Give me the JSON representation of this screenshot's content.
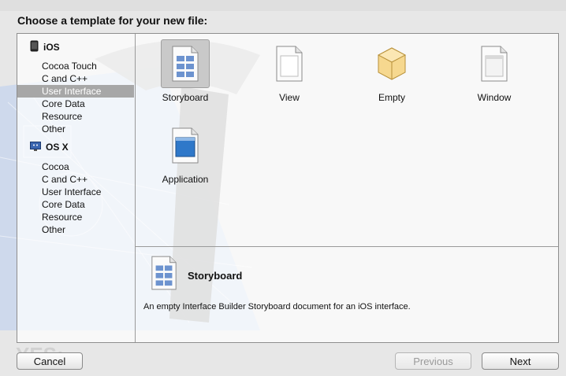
{
  "dialog": {
    "title": "Choose a template for your new file:"
  },
  "sidebar": {
    "groups": [
      {
        "label": "iOS",
        "icon": "iphone-icon",
        "items": [
          "Cocoa Touch",
          "C and C++",
          "User Interface",
          "Core Data",
          "Resource",
          "Other"
        ],
        "selected_index": 2
      },
      {
        "label": "OS X",
        "icon": "mac-finder-icon",
        "items": [
          "Cocoa",
          "C and C++",
          "User Interface",
          "Core Data",
          "Resource",
          "Other"
        ]
      }
    ]
  },
  "templates": [
    {
      "label": "Storyboard",
      "icon": "storyboard-icon",
      "selected": true
    },
    {
      "label": "View",
      "icon": "view-document-icon"
    },
    {
      "label": "Empty",
      "icon": "empty-cube-icon"
    },
    {
      "label": "Window",
      "icon": "window-document-icon"
    },
    {
      "label": "Application",
      "icon": "application-document-icon"
    }
  ],
  "detail": {
    "title": "Storyboard",
    "description": "An empty Interface Builder Storyboard document for an iOS interface."
  },
  "buttons": {
    "cancel": "Cancel",
    "previous": "Previous",
    "next": "Next"
  },
  "colors": {
    "selection": "#a7a7a7",
    "panel_border": "#8e8e8e"
  }
}
